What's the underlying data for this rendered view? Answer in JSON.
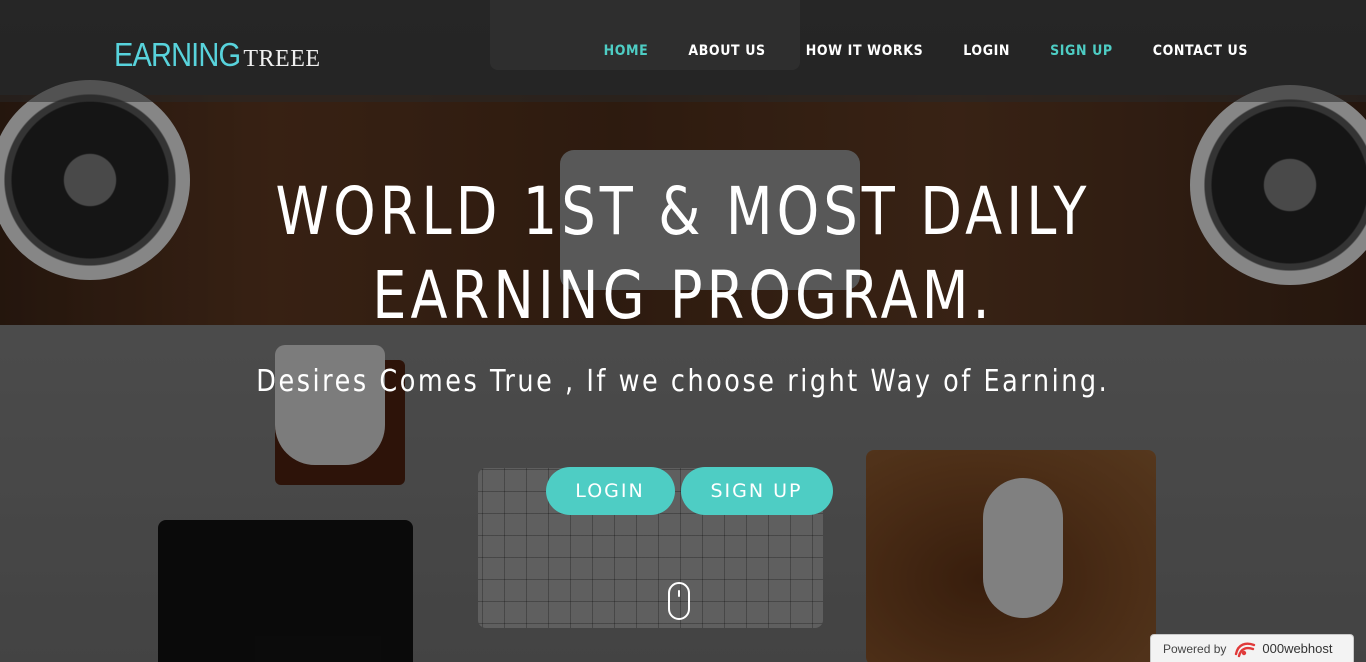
{
  "logo": {
    "main": "EARNING",
    "sub": "TREEE"
  },
  "nav": {
    "items": [
      {
        "label": "HOME",
        "active": true
      },
      {
        "label": "ABOUT US",
        "active": false
      },
      {
        "label": "HOW IT WORKS",
        "active": false
      },
      {
        "label": "LOGIN",
        "active": false
      },
      {
        "label": "SIGN UP",
        "active": true
      },
      {
        "label": "CONTACT US",
        "active": false
      }
    ]
  },
  "hero": {
    "title_line1": "WORLD 1ST & MOST DAILY",
    "title_line2": "EARNING PROGRAM.",
    "subtitle": "Desires Comes True , If we choose right Way of Earning.",
    "buttons": {
      "login": "LOGIN",
      "signup": "SIGN UP"
    }
  },
  "badge": {
    "text": "Powered by",
    "brand": "000webhost"
  },
  "colors": {
    "accent": "#4ecdc4",
    "logo_accent": "#58d3dc",
    "badge_logo": "#e03a3a"
  },
  "icons": {
    "scroll": "mouse-scroll-icon",
    "host": "000webhost-logo-icon"
  }
}
